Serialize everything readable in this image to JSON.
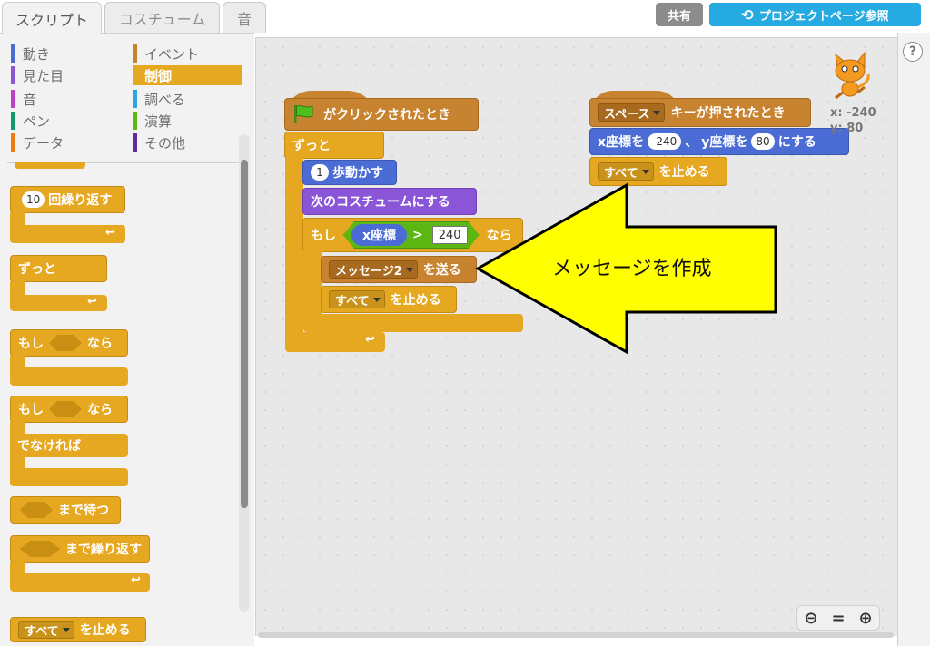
{
  "tabs": [
    "スクリプト",
    "コスチューム",
    "音"
  ],
  "top_buttons": {
    "share": "共有",
    "project_page": "プロジェクトページ参照"
  },
  "categories": [
    {
      "label": "動き",
      "color": "#4a6cd4"
    },
    {
      "label": "見た目",
      "color": "#8a55d7"
    },
    {
      "label": "音",
      "color": "#bb42c3"
    },
    {
      "label": "ペン",
      "color": "#0e9a6c"
    },
    {
      "label": "データ",
      "color": "#ee7d16"
    },
    {
      "label": "イベント",
      "color": "#c88330"
    },
    {
      "label": "制御",
      "color": "#e6a821"
    },
    {
      "label": "調べる",
      "color": "#2ca5e2"
    },
    {
      "label": "演算",
      "color": "#5cb712"
    },
    {
      "label": "その他",
      "color": "#632d99"
    }
  ],
  "palette": {
    "repeat_count": "10",
    "repeat": "回繰り返す",
    "forever": "ずっと",
    "if": "もし",
    "then": "なら",
    "else": "でなければ",
    "wait_until": "まで待つ",
    "repeat_until": "まで繰り返す",
    "stop_option": "すべて",
    "stop": "を止める"
  },
  "script1": {
    "hat": "がクリックされたとき",
    "forever": "ずっと",
    "move_count": "1",
    "move": "歩動かす",
    "next_costume": "次のコスチュームにする",
    "if": "もし",
    "x_position": "x座標",
    "gt": ">",
    "compare_value": "240",
    "then": "なら",
    "message": "メッセージ2",
    "broadcast": "を送る",
    "stop_option": "すべて",
    "stop": "を止める"
  },
  "script2": {
    "key": "スペース",
    "hat": "キーが押されたとき",
    "goto_x_label": "x座標を",
    "x_value": "-240",
    "comma": "、",
    "goto_y_label": "y座標を",
    "y_value": "80",
    "goto_end": "にする",
    "stop_option": "すべて",
    "stop": "を止める"
  },
  "sprite_info": {
    "x": "x: -240",
    "y": "y: 80"
  },
  "callout": "メッセージを作成",
  "zoom": {
    "out": "−",
    "reset": "=",
    "in": "+"
  },
  "help": "?",
  "colors": {
    "control": "#e6a821",
    "events": "#c88330",
    "motion": "#4a6cd4",
    "looks": "#8a55d7",
    "operators": "#5cb712",
    "callout_fill": "#ffff00",
    "share_button": "#8c8c8c",
    "project_button": "#25aae1"
  }
}
